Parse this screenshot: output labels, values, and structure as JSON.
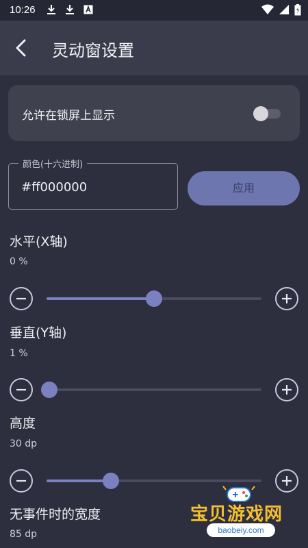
{
  "status_bar": {
    "time": "10:26",
    "icons": [
      "download-icon",
      "download-icon",
      "accessibility-icon",
      "wifi-icon",
      "signal-icon",
      "battery-icon"
    ]
  },
  "app_bar": {
    "title": "灵动窗设置",
    "back_icon": "back-arrow-icon"
  },
  "lockscreen": {
    "label": "允许在锁屏上显示",
    "enabled": false
  },
  "color": {
    "label": "颜色(十六进制)",
    "value": "#ff000000",
    "apply_label": "应用"
  },
  "sliders": [
    {
      "title": "水平(X轴)",
      "value_text": "0 %",
      "fraction": 0.5
    },
    {
      "title": "垂直(Y轴)",
      "value_text": "1 %",
      "fraction": 0.01
    },
    {
      "title": "高度",
      "value_text": "30 dp",
      "fraction": 0.3
    },
    {
      "title": "无事件时的宽度",
      "value_text": "85 dp"
    }
  ],
  "colors": {
    "background": "#2d2e3e",
    "app_bar": "#3b3c4b",
    "accent": "#7a80c0",
    "button": "#6e76b0"
  },
  "watermark": {
    "text": "宝贝游戏网",
    "url": "baobeiy.com"
  }
}
